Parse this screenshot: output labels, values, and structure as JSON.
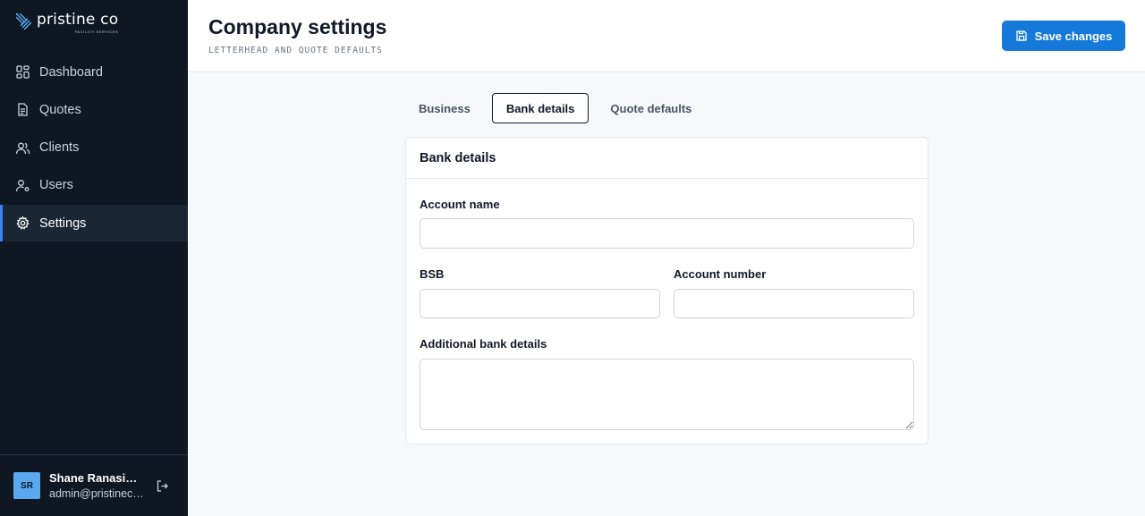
{
  "brand": {
    "name": "pristine co",
    "tagline": "FACILITY SERVICES"
  },
  "sidebar": {
    "items": [
      {
        "label": "Dashboard",
        "icon": "dashboard-icon"
      },
      {
        "label": "Quotes",
        "icon": "document-icon"
      },
      {
        "label": "Clients",
        "icon": "users-icon"
      },
      {
        "label": "Users",
        "icon": "user-gear-icon"
      },
      {
        "label": "Settings",
        "icon": "gear-icon",
        "active": true
      }
    ],
    "user": {
      "initials": "SR",
      "name": "Shane Ranasinghe",
      "email": "admin@pristineco.com.au"
    }
  },
  "header": {
    "title": "Company settings",
    "subtitle": "LETTERHEAD AND QUOTE DEFAULTS",
    "save_label": "Save changes"
  },
  "tabs": [
    {
      "label": "Business"
    },
    {
      "label": "Bank details",
      "active": true
    },
    {
      "label": "Quote defaults"
    }
  ],
  "card": {
    "title": "Bank details",
    "fields": {
      "account_name": {
        "label": "Account name",
        "value": ""
      },
      "bsb": {
        "label": "BSB",
        "value": ""
      },
      "account_number": {
        "label": "Account number",
        "value": ""
      },
      "additional": {
        "label": "Additional bank details",
        "value": ""
      }
    }
  },
  "colors": {
    "sidebar_bg": "#0f1722",
    "accent": "#1479d9",
    "active_marker": "#3b82f6"
  }
}
